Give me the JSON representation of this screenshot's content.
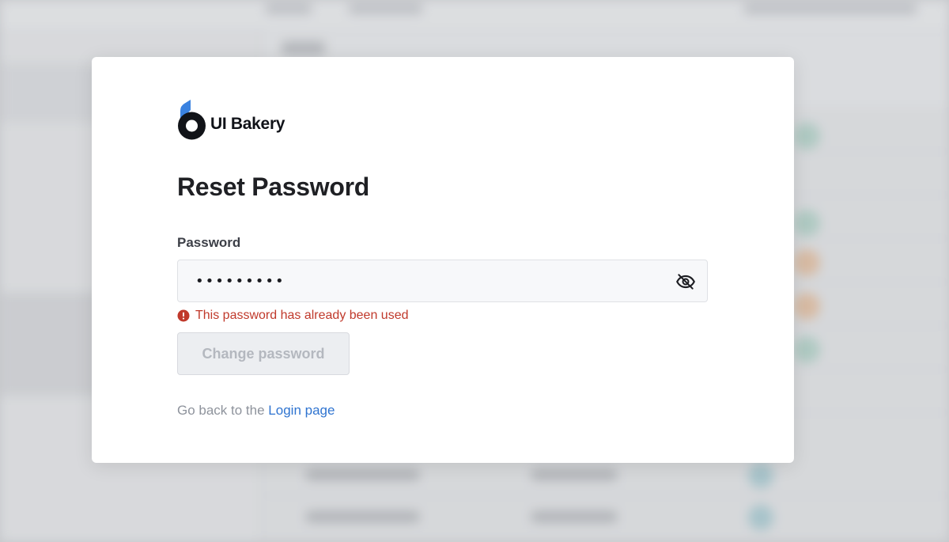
{
  "brand": {
    "name": "UI Bakery",
    "logo_icon": "ui-bakery-logo-icon",
    "logo_colors": {
      "accent": "#3a82e0",
      "ring": "#111318"
    }
  },
  "reset_form": {
    "title": "Reset Password",
    "password_label": "Password",
    "password_value": "•••••••••",
    "password_visibility_icon": "eye-off-icon",
    "error_icon": "alert-circle-icon",
    "error_message": "This password has already been used",
    "submit_label": "Change password",
    "submit_disabled": true,
    "back_prefix": "Go back to the ",
    "back_link_label": "Login page"
  },
  "colors": {
    "error": "#c0392b",
    "link": "#2f74d0",
    "text_primary": "#1f2024",
    "muted": "#8e939c"
  }
}
